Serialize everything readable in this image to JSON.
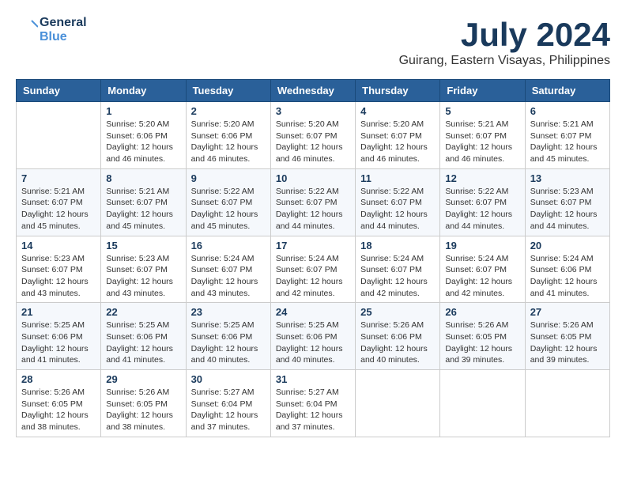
{
  "header": {
    "logo_line1": "General",
    "logo_line2": "Blue",
    "month_year": "July 2024",
    "location": "Guirang, Eastern Visayas, Philippines"
  },
  "days_of_week": [
    "Sunday",
    "Monday",
    "Tuesday",
    "Wednesday",
    "Thursday",
    "Friday",
    "Saturday"
  ],
  "weeks": [
    [
      {
        "day": "",
        "info": ""
      },
      {
        "day": "1",
        "info": "Sunrise: 5:20 AM\nSunset: 6:06 PM\nDaylight: 12 hours\nand 46 minutes."
      },
      {
        "day": "2",
        "info": "Sunrise: 5:20 AM\nSunset: 6:06 PM\nDaylight: 12 hours\nand 46 minutes."
      },
      {
        "day": "3",
        "info": "Sunrise: 5:20 AM\nSunset: 6:07 PM\nDaylight: 12 hours\nand 46 minutes."
      },
      {
        "day": "4",
        "info": "Sunrise: 5:20 AM\nSunset: 6:07 PM\nDaylight: 12 hours\nand 46 minutes."
      },
      {
        "day": "5",
        "info": "Sunrise: 5:21 AM\nSunset: 6:07 PM\nDaylight: 12 hours\nand 46 minutes."
      },
      {
        "day": "6",
        "info": "Sunrise: 5:21 AM\nSunset: 6:07 PM\nDaylight: 12 hours\nand 45 minutes."
      }
    ],
    [
      {
        "day": "7",
        "info": "Sunrise: 5:21 AM\nSunset: 6:07 PM\nDaylight: 12 hours\nand 45 minutes."
      },
      {
        "day": "8",
        "info": "Sunrise: 5:21 AM\nSunset: 6:07 PM\nDaylight: 12 hours\nand 45 minutes."
      },
      {
        "day": "9",
        "info": "Sunrise: 5:22 AM\nSunset: 6:07 PM\nDaylight: 12 hours\nand 45 minutes."
      },
      {
        "day": "10",
        "info": "Sunrise: 5:22 AM\nSunset: 6:07 PM\nDaylight: 12 hours\nand 44 minutes."
      },
      {
        "day": "11",
        "info": "Sunrise: 5:22 AM\nSunset: 6:07 PM\nDaylight: 12 hours\nand 44 minutes."
      },
      {
        "day": "12",
        "info": "Sunrise: 5:22 AM\nSunset: 6:07 PM\nDaylight: 12 hours\nand 44 minutes."
      },
      {
        "day": "13",
        "info": "Sunrise: 5:23 AM\nSunset: 6:07 PM\nDaylight: 12 hours\nand 44 minutes."
      }
    ],
    [
      {
        "day": "14",
        "info": "Sunrise: 5:23 AM\nSunset: 6:07 PM\nDaylight: 12 hours\nand 43 minutes."
      },
      {
        "day": "15",
        "info": "Sunrise: 5:23 AM\nSunset: 6:07 PM\nDaylight: 12 hours\nand 43 minutes."
      },
      {
        "day": "16",
        "info": "Sunrise: 5:24 AM\nSunset: 6:07 PM\nDaylight: 12 hours\nand 43 minutes."
      },
      {
        "day": "17",
        "info": "Sunrise: 5:24 AM\nSunset: 6:07 PM\nDaylight: 12 hours\nand 42 minutes."
      },
      {
        "day": "18",
        "info": "Sunrise: 5:24 AM\nSunset: 6:07 PM\nDaylight: 12 hours\nand 42 minutes."
      },
      {
        "day": "19",
        "info": "Sunrise: 5:24 AM\nSunset: 6:07 PM\nDaylight: 12 hours\nand 42 minutes."
      },
      {
        "day": "20",
        "info": "Sunrise: 5:24 AM\nSunset: 6:06 PM\nDaylight: 12 hours\nand 41 minutes."
      }
    ],
    [
      {
        "day": "21",
        "info": "Sunrise: 5:25 AM\nSunset: 6:06 PM\nDaylight: 12 hours\nand 41 minutes."
      },
      {
        "day": "22",
        "info": "Sunrise: 5:25 AM\nSunset: 6:06 PM\nDaylight: 12 hours\nand 41 minutes."
      },
      {
        "day": "23",
        "info": "Sunrise: 5:25 AM\nSunset: 6:06 PM\nDaylight: 12 hours\nand 40 minutes."
      },
      {
        "day": "24",
        "info": "Sunrise: 5:25 AM\nSunset: 6:06 PM\nDaylight: 12 hours\nand 40 minutes."
      },
      {
        "day": "25",
        "info": "Sunrise: 5:26 AM\nSunset: 6:06 PM\nDaylight: 12 hours\nand 40 minutes."
      },
      {
        "day": "26",
        "info": "Sunrise: 5:26 AM\nSunset: 6:05 PM\nDaylight: 12 hours\nand 39 minutes."
      },
      {
        "day": "27",
        "info": "Sunrise: 5:26 AM\nSunset: 6:05 PM\nDaylight: 12 hours\nand 39 minutes."
      }
    ],
    [
      {
        "day": "28",
        "info": "Sunrise: 5:26 AM\nSunset: 6:05 PM\nDaylight: 12 hours\nand 38 minutes."
      },
      {
        "day": "29",
        "info": "Sunrise: 5:26 AM\nSunset: 6:05 PM\nDaylight: 12 hours\nand 38 minutes."
      },
      {
        "day": "30",
        "info": "Sunrise: 5:27 AM\nSunset: 6:04 PM\nDaylight: 12 hours\nand 37 minutes."
      },
      {
        "day": "31",
        "info": "Sunrise: 5:27 AM\nSunset: 6:04 PM\nDaylight: 12 hours\nand 37 minutes."
      },
      {
        "day": "",
        "info": ""
      },
      {
        "day": "",
        "info": ""
      },
      {
        "day": "",
        "info": ""
      }
    ]
  ]
}
